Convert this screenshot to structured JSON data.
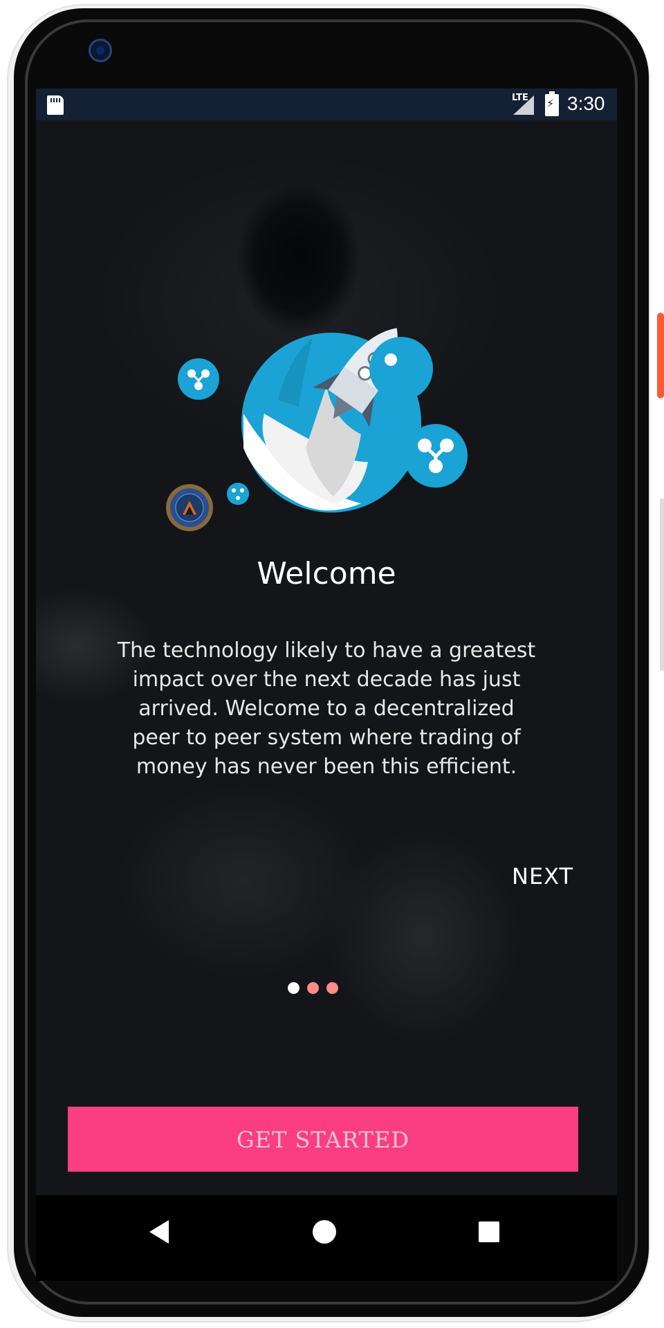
{
  "status_bar": {
    "network_type": "LTE",
    "time": "3:30",
    "icons": [
      "sd-card-icon",
      "signal-icon",
      "battery-charging-icon"
    ]
  },
  "onboarding": {
    "title": "Welcome",
    "description": "The technology likely to have a greatest impact over the next decade has just arrived. Welcome to a decentralized peer to peer system where trading of money has never been this efficient.",
    "next_label": "NEXT",
    "page_indicator": {
      "current": 1,
      "total": 3
    },
    "get_started_label": "GET STARTED",
    "illustration_icons": [
      "rocket-icon",
      "ripple-coin-icon",
      "blockchain-badge-icon"
    ]
  },
  "nav_bar": {
    "icons": [
      "back-icon",
      "home-icon",
      "recents-icon"
    ]
  },
  "colors": {
    "accent": "#fb3e7f",
    "coin_blue": "#1aa3d4",
    "status_bar_bg": "#142033",
    "dot_active": "#ffffff",
    "dot_inactive": "#ff8a8a"
  }
}
